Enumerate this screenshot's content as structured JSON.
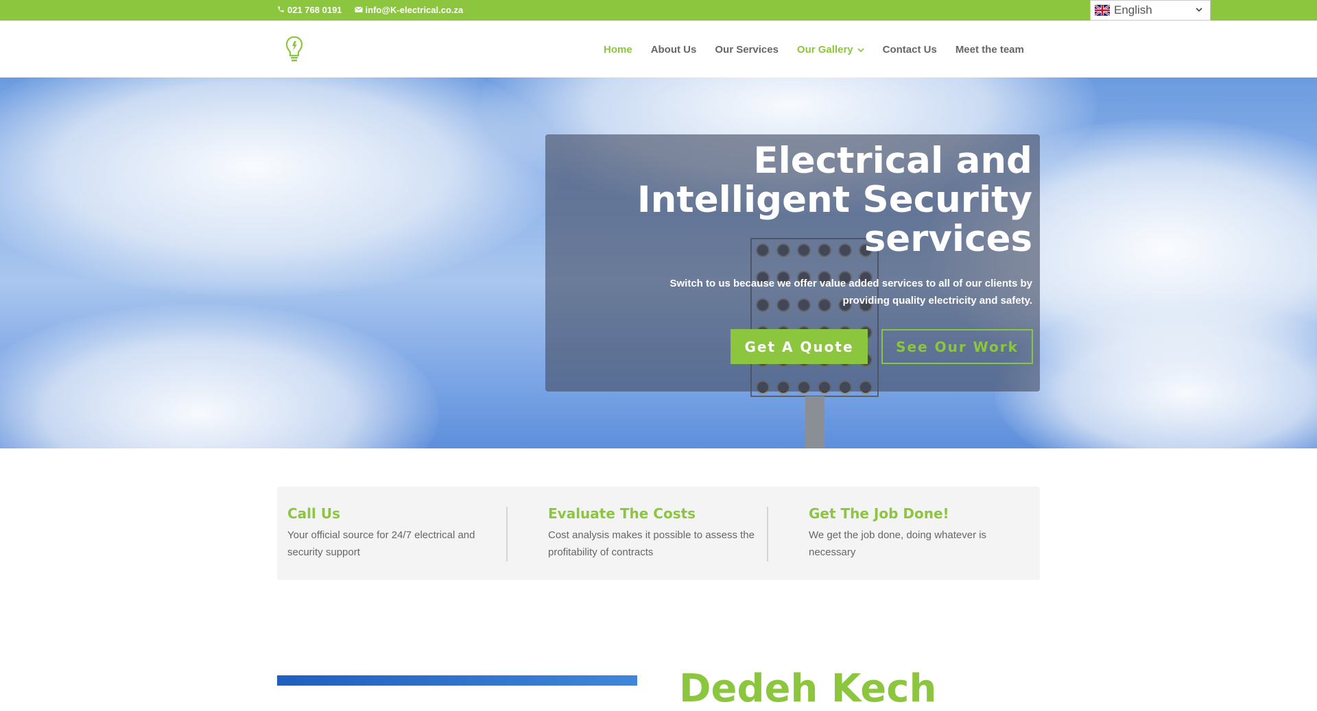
{
  "topbar": {
    "phone": "021 768 0191",
    "email": "info@K-electrical.co.za",
    "language": "English"
  },
  "nav": {
    "items": [
      {
        "label": "Home"
      },
      {
        "label": "About Us"
      },
      {
        "label": "Our Services"
      },
      {
        "label": "Our Gallery"
      },
      {
        "label": "Contact Us"
      },
      {
        "label": "Meet the team"
      }
    ]
  },
  "hero": {
    "title": "Electrical and Intelligent Security services",
    "subtitle": "Switch to us because we offer value added services to all of our clients by providing quality electricity and safety.",
    "quote_button": "Get A Quote",
    "work_button": "See Our Work"
  },
  "features": [
    {
      "heading": "Call Us",
      "text": "Your official source for 24/7 electrical and security support"
    },
    {
      "heading": "Evaluate The Costs",
      "text": "Cost analysis makes it possible to assess the profitability of contracts"
    },
    {
      "heading": "Get The Job Done!",
      "text": "We get the job done, doing whatever is necessary"
    }
  ],
  "section": {
    "title_partial": "Dedeh Kech"
  },
  "colors": {
    "brand_green": "#8cc63f",
    "nav_text": "#666666",
    "panel_overlay": "rgba(70,78,100,0.62)"
  },
  "icons": {
    "phone": "phone-icon",
    "email": "envelope-icon",
    "flag": "uk-flag-icon",
    "logo": "lightbulb-logo-icon"
  }
}
